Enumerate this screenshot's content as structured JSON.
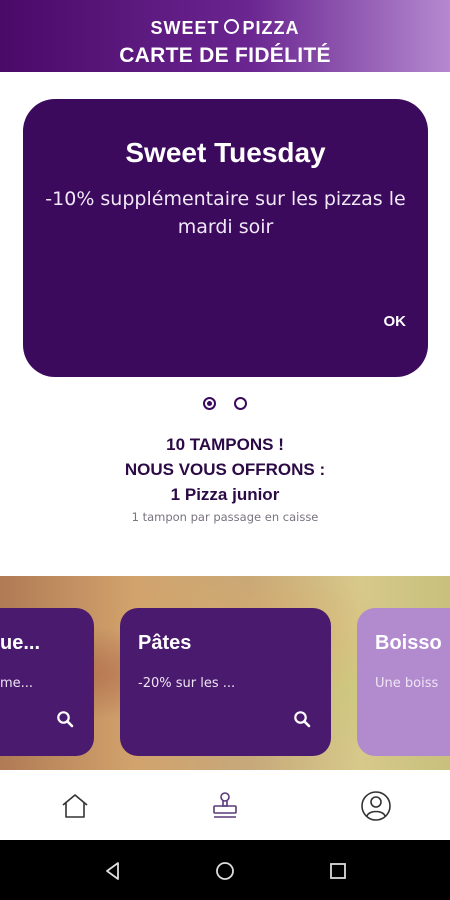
{
  "header": {
    "brand_left": "SWEET",
    "brand_right": "PIZZA",
    "title": "CARTE DE FIDÉLITÉ"
  },
  "promo": {
    "title": "Sweet Tuesday",
    "text": "-10% supplémentaire sur les pizzas le mardi soir",
    "ok_label": "OK"
  },
  "carousel": {
    "pages": 2,
    "active_page": 1
  },
  "loyalty": {
    "line1": "10 TAMPONS !",
    "line2": "NOUS VOUS OFFRONS :",
    "line3": "1 Pizza junior",
    "note": "1 tampon par passage en caisse"
  },
  "categories": [
    {
      "name": "ue...",
      "desc": "me...",
      "color": "#4a1a6e"
    },
    {
      "name": "Pâtes",
      "desc": "-20% sur les ...",
      "color": "#4a1a6e"
    },
    {
      "name": "Boisso",
      "desc": "Une boiss",
      "color": "#b28bcf"
    }
  ],
  "nav": {
    "items": [
      "home-icon",
      "stamp-icon",
      "profile-icon"
    ]
  },
  "colors": {
    "primary": "#3b0a5c",
    "accent_light": "#b28bcf",
    "header_from": "#4a0a68",
    "header_to": "#b489d0"
  }
}
